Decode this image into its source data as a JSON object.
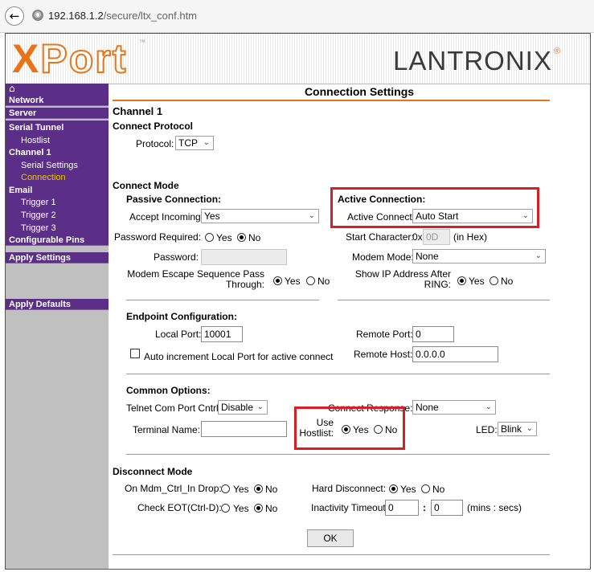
{
  "browser": {
    "url_host": "192.168.1.2",
    "url_path": "/secure/ltx_conf.htm"
  },
  "header": {
    "product_logo": "XPort",
    "brand_logo": "LANTRONIX"
  },
  "sidebar": {
    "network": "Network",
    "server": "Server",
    "serial_tunnel": "Serial Tunnel",
    "hostlist": "Hostlist",
    "channel1": "Channel 1",
    "serial_settings": "Serial Settings",
    "connection": "Connection",
    "email": "Email",
    "trigger1": "Trigger 1",
    "trigger2": "Trigger 2",
    "trigger3": "Trigger 3",
    "configurable_pins": "Configurable Pins",
    "apply_settings": "Apply Settings",
    "apply_defaults": "Apply Defaults"
  },
  "page": {
    "title": "Connection Settings",
    "channel": "Channel 1"
  },
  "protocol": {
    "section": "Connect Protocol",
    "label": "Protocol:",
    "value": "TCP"
  },
  "connect_mode": {
    "section": "Connect Mode",
    "passive_title": "Passive Connection:",
    "accept_incoming_label": "Accept Incoming:",
    "accept_incoming_value": "Yes",
    "password_required_label": "Password Required:",
    "yes": "Yes",
    "no": "No",
    "password_label": "Password:",
    "modem_escape_line1": "Modem Escape Sequence Pass",
    "modem_escape_line2": "Through:",
    "active_title": "Active Connection:",
    "active_connect_label": "Active Connect:",
    "active_connect_value": "Auto Start",
    "start_char_label": "Start Character:",
    "start_char_prefix": "0x",
    "start_char_value": "0D",
    "start_char_suffix": "(in Hex)",
    "modem_mode_label": "Modem Mode:",
    "modem_mode_value": "None",
    "show_ip_line1": "Show IP Address After",
    "show_ip_line2": "RING:"
  },
  "endpoint": {
    "title": "Endpoint Configuration:",
    "local_port_label": "Local Port:",
    "local_port_value": "10001",
    "auto_increment_label": "Auto increment Local Port for active connect",
    "remote_port_label": "Remote Port:",
    "remote_port_value": "0",
    "remote_host_label": "Remote Host:",
    "remote_host_value": "0.0.0.0"
  },
  "common": {
    "title": "Common Options:",
    "telnet_label": "Telnet Com Port Cntrl:",
    "telnet_value": "Disable",
    "connect_response_label": "Connect Response:",
    "connect_response_value": "None",
    "terminal_name_label": "Terminal Name:",
    "terminal_name_value": "",
    "use_hostlist_line1": "Use",
    "use_hostlist_line2": "Hostlist:",
    "led_label": "LED:",
    "led_value": "Blink"
  },
  "disconnect": {
    "section": "Disconnect Mode",
    "mdm_label": "On Mdm_Ctrl_In Drop:",
    "eot_label": "Check EOT(Ctrl-D):",
    "hard_label": "Hard Disconnect:",
    "inactivity_label": "Inactivity Timeout:",
    "inactivity_min": "0",
    "colon": ":",
    "inactivity_sec": "0",
    "inactivity_units": "(mins : secs)"
  },
  "ok_label": "OK",
  "colors": {
    "accent": "#e8741a",
    "nav": "#5b2e87",
    "active_nav": "#f0c400",
    "highlight": "#d91f26"
  }
}
